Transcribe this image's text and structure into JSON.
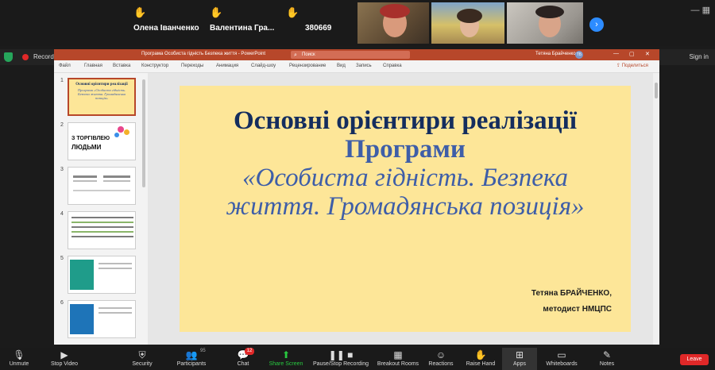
{
  "participants": [
    {
      "name": "Олена Іванченко"
    },
    {
      "name": "Валентина  Гра..."
    },
    {
      "name": "380669"
    }
  ],
  "recording": {
    "label": "Recording..."
  },
  "signin": "Sign in",
  "ppt": {
    "doc_title": "Програма Особиста гідність Безпека життя  -  PowerPoint",
    "search_placeholder": "Поиск",
    "user_name": "Тетяна Брайченко",
    "user_initials": "ТБ",
    "ribbon_tabs": [
      "Файл",
      "Главная",
      "Вставка",
      "Конструктор",
      "Переходы",
      "Анимация",
      "Слайд-шоу",
      "Рецензирование",
      "Вид",
      "Запись",
      "Справка"
    ],
    "share_label": "Поделиться",
    "thumb_numbers": [
      "1",
      "2",
      "3",
      "4",
      "5",
      "6"
    ],
    "thumb_texts": {
      "t1_title": "Основні орієнтири реалізації",
      "t1_sub": "Програми «Особиста гідність. Безпека життя. Громадянська позиція»",
      "t2_line1": "З ТОРГІВЛЕЮ",
      "t2_line2": "ЛЮДЬМИ"
    }
  },
  "slide": {
    "title": "Основні орієнтири реалізації",
    "program": "Програми",
    "quote_line1": "«Особиста гідність. Безпека",
    "quote_line2": "життя. Громадянська позиція»",
    "author": "Тетяна БРАЙЧЕНКО,",
    "role": "методист НМЦПС"
  },
  "toolbar": {
    "items": [
      {
        "label": "Unmute"
      },
      {
        "label": "Stop Video"
      },
      {
        "label": "Security"
      },
      {
        "label": "Participants",
        "count": "95"
      },
      {
        "label": "Chat",
        "badge": "12"
      },
      {
        "label": "Share Screen"
      },
      {
        "label": "Pause/Stop Recording"
      },
      {
        "label": "Breakout Rooms"
      },
      {
        "label": "Reactions"
      },
      {
        "label": "Raise Hand"
      },
      {
        "label": "Apps"
      },
      {
        "label": "Whiteboards"
      },
      {
        "label": "Notes"
      }
    ],
    "leave_label": "Leave"
  },
  "colors": {
    "ppt_accent": "#b7472a",
    "slide_bg": "#fde698",
    "title_navy": "#142d5e",
    "title_blue": "#3e5ea8",
    "share_green": "#28c840",
    "leave_red": "#e02828"
  }
}
